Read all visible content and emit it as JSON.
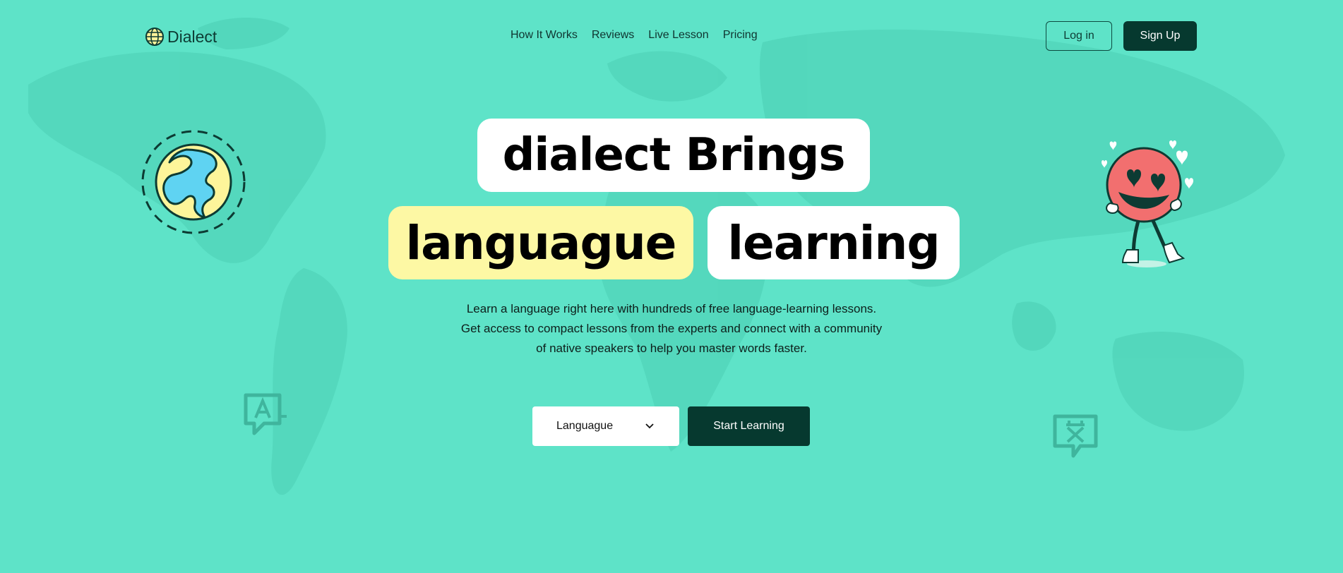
{
  "header": {
    "brand": "Dialect",
    "nav": [
      "How It Works",
      "Reviews",
      "Live Lesson",
      "Pricing"
    ],
    "login_label": "Log in",
    "signup_label": "Sign Up"
  },
  "hero": {
    "line1": "dialect Brings",
    "word_highlight": "languague",
    "word_plain": "learning",
    "description": [
      "Learn a language right here with hundreds of free language-learning lessons.",
      "Get access to compact lessons from the experts and connect with a community",
      "of native speakers to help you master words faster."
    ],
    "language_select": "Languague",
    "start_label": "Start Learning"
  },
  "colors": {
    "background": "#5ee3c8",
    "dark_green": "#06392f",
    "highlight_yellow": "#fdf8a4",
    "globe_blue": "#5fd3f2",
    "character_red": "#f26f6f"
  },
  "icons": [
    "globe-icon",
    "chevron-down-icon",
    "translate-a-icon",
    "translate-x-icon"
  ]
}
